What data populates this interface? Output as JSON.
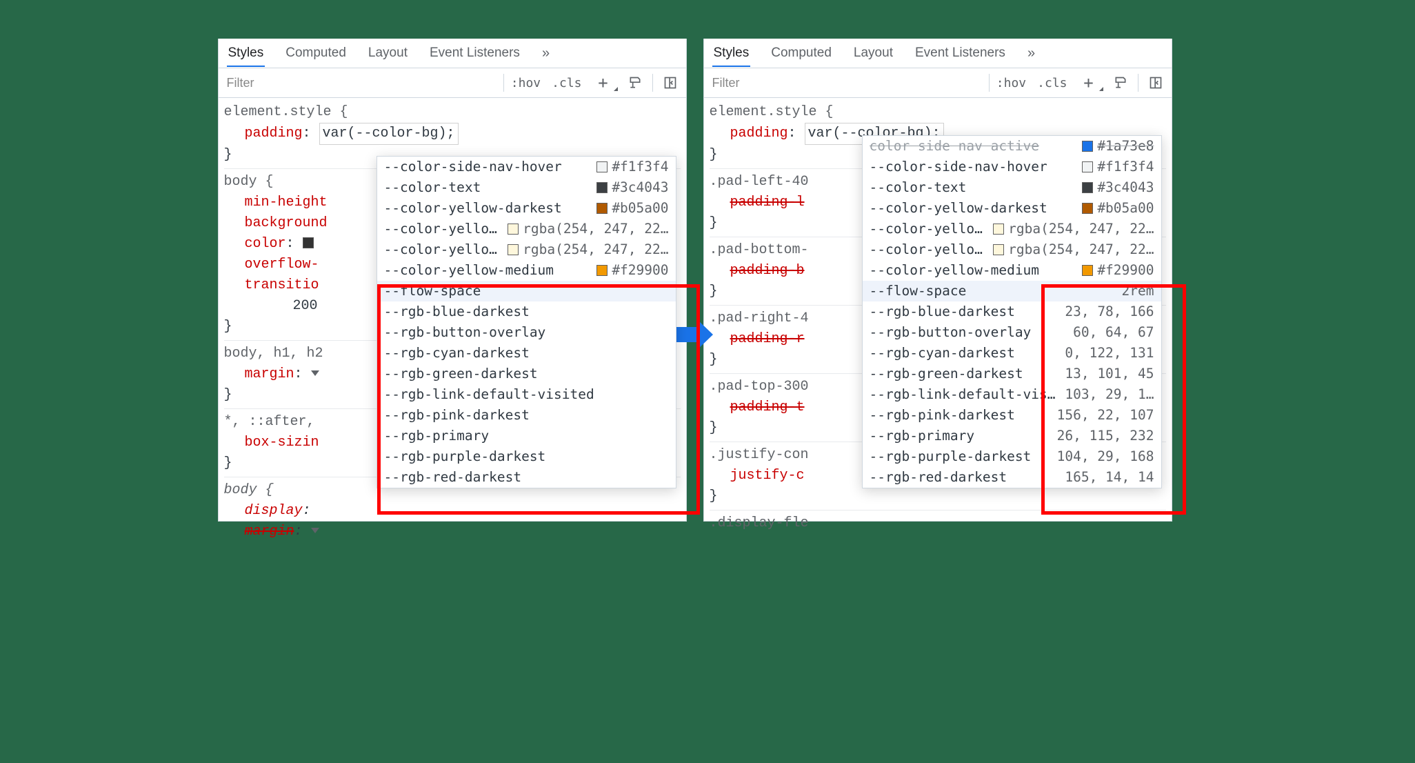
{
  "tabs": {
    "styles": "Styles",
    "computed": "Computed",
    "layout": "Layout",
    "listeners": "Event Listeners",
    "more": "»"
  },
  "toolbar": {
    "filter_ph": "Filter",
    "hov": ":hov",
    "cls": ".cls"
  },
  "left": {
    "r1_sel": "element.style {",
    "r1_prop": "padding",
    "r1_val": "var(--color-bg);",
    "r1_close": "}",
    "r2_sel": "body {",
    "r2_p1": "min-height",
    "r2_p2": "background",
    "r2_p3": "color",
    "r2_p4": "overflow-",
    "r2_p5": "transitio",
    "r2_indent": "200",
    "r2_close": "}",
    "r3_sel": "body, h1, h2",
    "r3_p1": "margin",
    "r3_close": "}",
    "r4_sel": "*, ::after,",
    "r4_p1": "box-sizin",
    "r4_close": "}",
    "r5_sel": "body {",
    "r5_p1": "display",
    "r5_p2": "margin",
    "r5_close": ""
  },
  "right": {
    "r1_sel": "element.style {",
    "r1_prop": "padding",
    "r1_val": "var(--color-bg);",
    "r1_close": "}",
    "r2_sel": ".pad-left-40",
    "r2_p1": "padding-l",
    "r2_close": "}",
    "r3_sel": ".pad-bottom-",
    "r3_p1": "padding-b",
    "r3_close": "}",
    "r4_sel": ".pad-right-4",
    "r4_p1": "padding-r",
    "r4_close": "}",
    "r5_sel": ".pad-top-300",
    "r5_p1": "padding-t",
    "r5_close": "}",
    "r6_sel": ".justify-con",
    "r6_p1": "justify-c",
    "r6_close": "}",
    "r7_sel": ".display-fle"
  },
  "dd_top": [
    {
      "name": "--color-side-nav-hover",
      "sw": "#f1f3f4",
      "val": "#f1f3f4"
    },
    {
      "name": "--color-text",
      "sw": "#3c4043",
      "val": "#3c4043"
    },
    {
      "name": "--color-yellow-darkest",
      "sw": "#b05a00",
      "val": "#b05a00"
    },
    {
      "name": "--color-yellow-lig…",
      "sw": "rgba(254,247,220,1)",
      "val": "rgba(254, 247, 22…"
    },
    {
      "name": "--color-yellow-ligh…",
      "sw": "rgba(254,247,220,1)",
      "val": "rgba(254, 247, 22…"
    },
    {
      "name": "--color-yellow-medium",
      "sw": "#f29900",
      "val": "#f29900"
    }
  ],
  "dd_right_top0": {
    "name": "color side nav active",
    "sw": "#1a73e8",
    "val": "#1a73e8"
  },
  "dd_left_bottom": [
    {
      "name": "--flow-space",
      "hilite": true
    },
    {
      "name": "--rgb-blue-darkest"
    },
    {
      "name": "--rgb-button-overlay"
    },
    {
      "name": "--rgb-cyan-darkest"
    },
    {
      "name": "--rgb-green-darkest"
    },
    {
      "name": "--rgb-link-default-visited"
    },
    {
      "name": "--rgb-pink-darkest"
    },
    {
      "name": "--rgb-primary"
    },
    {
      "name": "--rgb-purple-darkest"
    },
    {
      "name": "--rgb-red-darkest"
    }
  ],
  "dd_right_bottom": [
    {
      "name": "--flow-space",
      "val": "2rem",
      "hilite": true
    },
    {
      "name": "--rgb-blue-darkest",
      "val": "23, 78, 166"
    },
    {
      "name": "--rgb-button-overlay",
      "val": "60, 64, 67"
    },
    {
      "name": "--rgb-cyan-darkest",
      "val": "0, 122, 131"
    },
    {
      "name": "--rgb-green-darkest",
      "val": "13, 101, 45"
    },
    {
      "name": "--rgb-link-default-visited…",
      "val": "103, 29, 1…"
    },
    {
      "name": "--rgb-pink-darkest",
      "val": "156, 22, 107"
    },
    {
      "name": "--rgb-primary",
      "val": "26, 115, 232"
    },
    {
      "name": "--rgb-purple-darkest",
      "val": "104, 29, 168"
    },
    {
      "name": "--rgb-red-darkest",
      "val": "165, 14, 14"
    }
  ]
}
